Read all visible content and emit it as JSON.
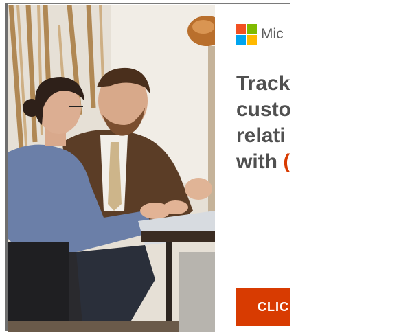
{
  "ad": {
    "brand_text": "Mic",
    "headline_lines": [
      "Track",
      "custo",
      "relati",
      "with "
    ],
    "headline_accent": "(",
    "cta_label": "CLIC"
  },
  "colors": {
    "ms_red": "#f25022",
    "ms_green": "#7fba00",
    "ms_blue": "#00a4ef",
    "ms_yellow": "#ffb900",
    "cta_bg": "#d83b01",
    "headline": "#505050"
  },
  "icons": {
    "logo": "microsoft-logo-icon"
  }
}
